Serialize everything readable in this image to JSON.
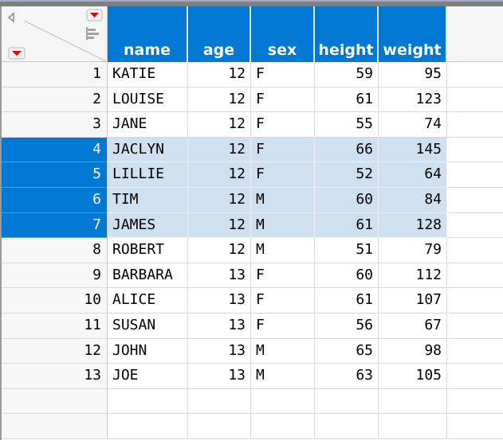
{
  "columns": [
    "name",
    "age",
    "sex",
    "height",
    "weight"
  ],
  "rows": [
    {
      "n": "1",
      "name": "KATIE",
      "age": "12",
      "sex": "F",
      "height": "59",
      "weight": "95",
      "selected": false
    },
    {
      "n": "2",
      "name": "LOUISE",
      "age": "12",
      "sex": "F",
      "height": "61",
      "weight": "123",
      "selected": false
    },
    {
      "n": "3",
      "name": "JANE",
      "age": "12",
      "sex": "F",
      "height": "55",
      "weight": "74",
      "selected": false
    },
    {
      "n": "4",
      "name": "JACLYN",
      "age": "12",
      "sex": "F",
      "height": "66",
      "weight": "145",
      "selected": true
    },
    {
      "n": "5",
      "name": "LILLIE",
      "age": "12",
      "sex": "F",
      "height": "52",
      "weight": "64",
      "selected": true
    },
    {
      "n": "6",
      "name": "TIM",
      "age": "12",
      "sex": "M",
      "height": "60",
      "weight": "84",
      "selected": true
    },
    {
      "n": "7",
      "name": "JAMES",
      "age": "12",
      "sex": "M",
      "height": "61",
      "weight": "128",
      "selected": true
    },
    {
      "n": "8",
      "name": "ROBERT",
      "age": "12",
      "sex": "M",
      "height": "51",
      "weight": "79",
      "selected": false
    },
    {
      "n": "9",
      "name": "BARBARA",
      "age": "13",
      "sex": "F",
      "height": "60",
      "weight": "112",
      "selected": false
    },
    {
      "n": "10",
      "name": "ALICE",
      "age": "13",
      "sex": "F",
      "height": "61",
      "weight": "107",
      "selected": false
    },
    {
      "n": "11",
      "name": "SUSAN",
      "age": "13",
      "sex": "F",
      "height": "56",
      "weight": "67",
      "selected": false
    },
    {
      "n": "12",
      "name": "JOHN",
      "age": "13",
      "sex": "M",
      "height": "65",
      "weight": "98",
      "selected": false
    },
    {
      "n": "13",
      "name": "JOE",
      "age": "13",
      "sex": "M",
      "height": "63",
      "weight": "105",
      "selected": false
    }
  ],
  "colors": {
    "header": "#0078d4",
    "selected_row_number": "#0078d4",
    "selected_cell": "#cfe0f1"
  }
}
